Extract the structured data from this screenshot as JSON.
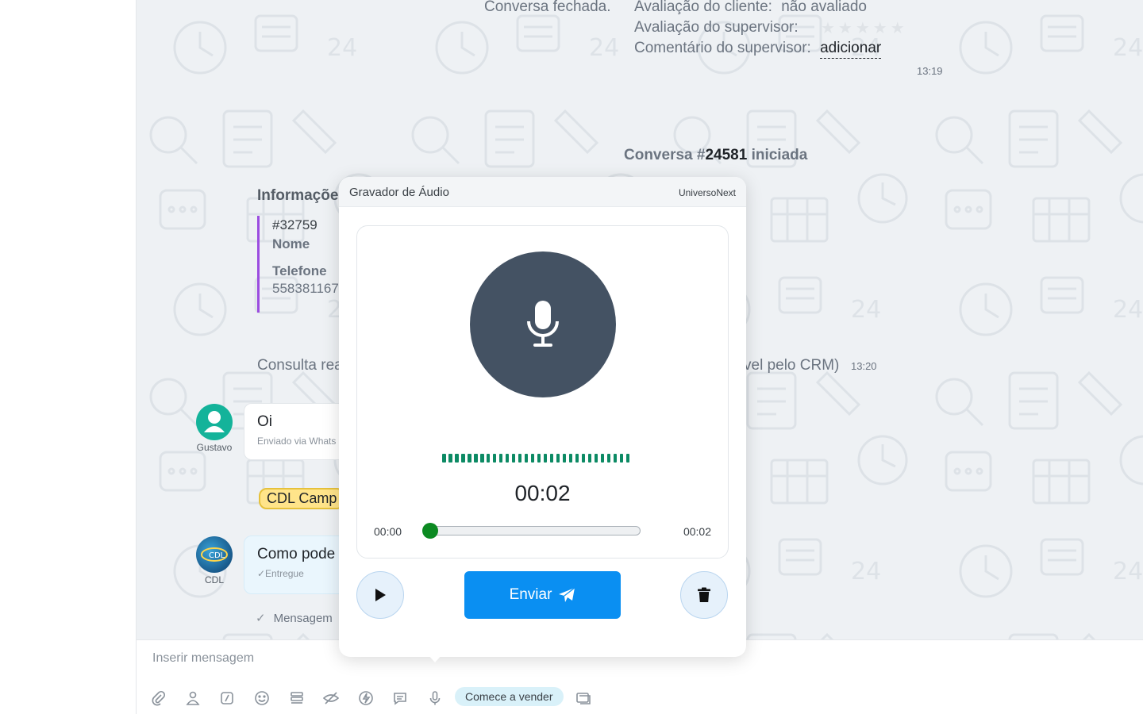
{
  "conversation_end": {
    "closed_text": "Conversa fechada.",
    "client_rating_label": "Avaliação do cliente:",
    "client_rating_value": "não avaliado",
    "supervisor_rating_label": "Avaliação do supervisor:",
    "supervisor_comment_label": "Comentário do supervisor:",
    "supervisor_comment_action": "adicionar",
    "time": "13:19"
  },
  "conversation_start": {
    "prefix": "Conversa #",
    "number": "24581",
    "suffix": " iniciada"
  },
  "info": {
    "title": "Informaçõe",
    "id": "#32759",
    "name_label": "Nome",
    "phone_label": "Telefone",
    "phone_value": "558381167"
  },
  "crm_line": {
    "left_text": "Consulta rea",
    "right_text": "vel pelo CRM)",
    "time": "13:20"
  },
  "messages": [
    {
      "sender": "Gustavo",
      "text": "Oi",
      "meta": "Enviado via Whats"
    },
    {
      "sender": "CDL",
      "text": "Como pode",
      "meta": "✓Entregue"
    }
  ],
  "campaign_tag": "CDL Camp",
  "message_status_fragment": "Mensagem",
  "composer": {
    "placeholder": "Inserir mensagem",
    "sell_pill": "Comece a vender"
  },
  "recorder": {
    "title": "Gravador de Áudio",
    "brand": "UniversoNext",
    "timer": "00:02",
    "time_start": "00:00",
    "time_end": "00:02",
    "progress": 0.0,
    "send_label": "Enviar",
    "accent_color": "#0a8ff2",
    "mic_bg_color": "#445263",
    "wave_color": "#0c8a64"
  }
}
